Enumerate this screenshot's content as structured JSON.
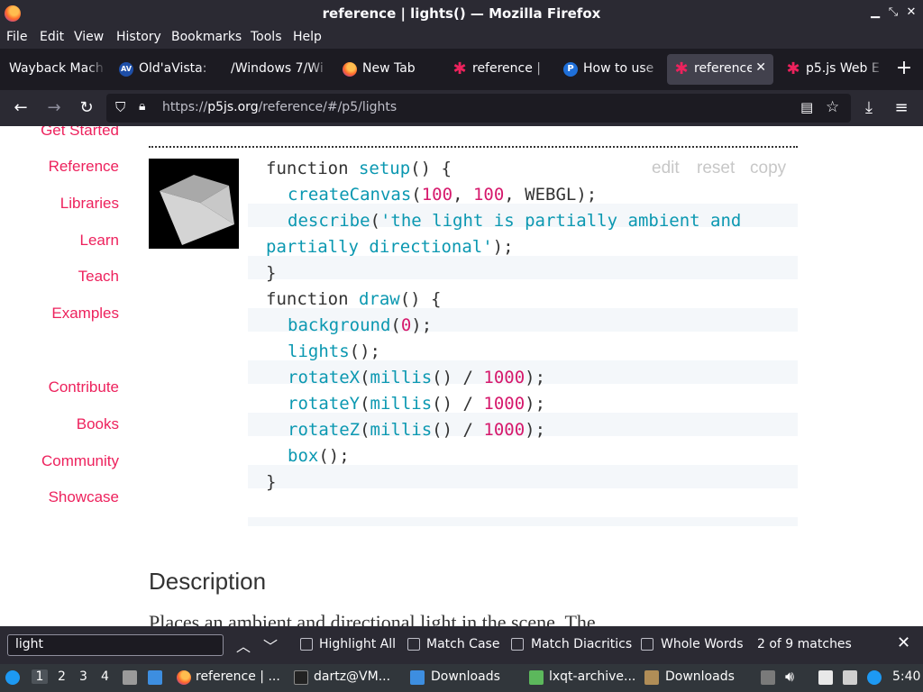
{
  "window": {
    "title": "reference | lights() — Mozilla Firefox"
  },
  "menu": [
    "File",
    "Edit",
    "View",
    "History",
    "Bookmarks",
    "Tools",
    "Help"
  ],
  "tabs": [
    {
      "label": "Wayback Mach"
    },
    {
      "label": "Old'aVista:"
    },
    {
      "label": "/Windows 7/Wi"
    },
    {
      "label": "New Tab"
    },
    {
      "label": "reference |"
    },
    {
      "label": "How to use"
    },
    {
      "label": "reference"
    },
    {
      "label": "p5.js Web E"
    }
  ],
  "url": {
    "prefix": "https://",
    "host": "p5js.org",
    "path": "/reference/#/p5/lights"
  },
  "sidebar": [
    "Get Started",
    "Reference",
    "Libraries",
    "Learn",
    "Teach",
    "Examples",
    "Contribute",
    "Books",
    "Community",
    "Showcase"
  ],
  "code_buttons": [
    "edit",
    "reset",
    "copy"
  ],
  "code": {
    "l1_kw": "function ",
    "l1_fn": "setup",
    "l1_rest": "() {",
    "l2_fn": "createCanvas",
    "l2_a": "(",
    "l2_n1": "100",
    "l2_b": ", ",
    "l2_n2": "100",
    "l2_c": ", WEBGL);",
    "l3_fn": "describe",
    "l3_a": "(",
    "l3_str": "'the light is partially ambient and",
    "l4_str": "partially directional'",
    "l4_rest": ");",
    "l5": "}",
    "l6_kw": "function ",
    "l6_fn": "draw",
    "l6_rest": "() {",
    "l7_fn": "background",
    "l7_a": "(",
    "l7_n": "0",
    "l7_b": ");",
    "l8_fn": "lights",
    "l8_rest": "();",
    "l9_fn": "rotateX",
    "l9_a": "(",
    "l9_fn2": "millis",
    "l9_b": "() / ",
    "l9_n": "1000",
    "l9_c": ");",
    "l10_fn": "rotateY",
    "l10_a": "(",
    "l10_fn2": "millis",
    "l10_b": "() / ",
    "l10_n": "1000",
    "l10_c": ");",
    "l11_fn": "rotateZ",
    "l11_a": "(",
    "l11_fn2": "millis",
    "l11_b": "() / ",
    "l11_n": "1000",
    "l11_c": ");",
    "l12_fn": "box",
    "l12_rest": "();",
    "l13": "}"
  },
  "description": {
    "title": "Description",
    "text": "Places an ambient and directional light in the scene. The"
  },
  "findbar": {
    "query": "light",
    "options": [
      "Highlight All",
      "Match Case",
      "Match Diacritics",
      "Whole Words"
    ],
    "status": "2 of 9 matches"
  },
  "taskbar": {
    "workspaces": [
      "1",
      "2",
      "3",
      "4"
    ],
    "items": [
      "reference | ...",
      "dartz@VM...",
      "Downloads",
      "lxqt-archive...",
      "Downloads"
    ],
    "clock": "5:40"
  },
  "colors": {
    "accent": "#ed225d",
    "code_fn": "#0b98b1",
    "code_num": "#d6196c"
  }
}
